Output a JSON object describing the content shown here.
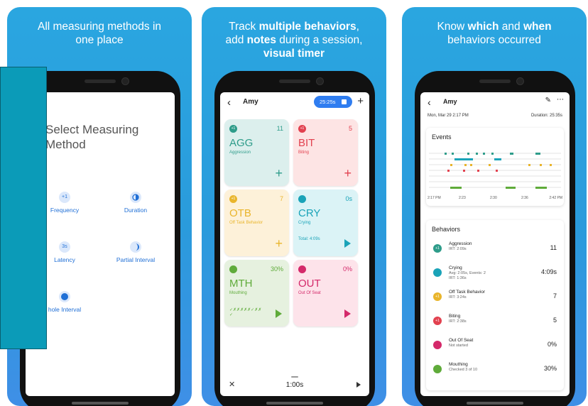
{
  "panel1": {
    "caption_line1": "All measuring methods in",
    "caption_line2": "one place",
    "title_line1": "Select Measuring",
    "title_line2": "Method",
    "methods": [
      {
        "label": "Frequency",
        "icon": "+1"
      },
      {
        "label": "Duration",
        "icon": "duration-icon"
      },
      {
        "label": "Latency",
        "icon": "3s"
      },
      {
        "label": "Partial Interval",
        "icon": "partial-interval-icon"
      },
      {
        "label": "hole Interval",
        "icon": "whole-interval-icon"
      }
    ]
  },
  "panel2": {
    "caption_line1_pre": "Track ",
    "caption_line1_bold": "multiple behaviors",
    "caption_line1_post": ",",
    "caption_line2_pre": "add ",
    "caption_line2_bold": "notes",
    "caption_line2_post": " during a session,",
    "caption_line3_bold": "visual timer",
    "user": "Amy",
    "timer": "25:25s",
    "cards": [
      {
        "abbr": "AGG",
        "name": "Aggression",
        "count": "11",
        "icon": "+1",
        "color": "#2e9c8a",
        "bg": "#dcefed"
      },
      {
        "abbr": "BIT",
        "name": "Biting",
        "count": "5",
        "icon": "+1",
        "color": "#e2414f",
        "bg": "#fde4e4"
      },
      {
        "abbr": "OTB",
        "name": "Off Task Behavior",
        "count": "7",
        "icon": "+1",
        "color": "#e9b52c",
        "bg": "#fdf1d9"
      },
      {
        "abbr": "CRY",
        "name": "Crying",
        "count": "0s",
        "extra": "Total: 4:09s",
        "icon": "duration-icon",
        "color": "#1aa3b8",
        "bg": "#dbf3f6"
      },
      {
        "abbr": "MTH",
        "name": "Mouthing",
        "count": "30%",
        "extra": "✓✗✗✗✗✗✓✗✗ ✓",
        "icon": "interval-icon",
        "color": "#5fab3a",
        "bg": "#e6f1df"
      },
      {
        "abbr": "OUT",
        "name": "Out Of Seat",
        "count": "0%",
        "icon": "interval-icon",
        "color": "#d4296a",
        "bg": "#fde3ea"
      }
    ],
    "bottom_timer": "1:00s"
  },
  "panel3": {
    "caption_line1_pre": "Know ",
    "caption_line1_bold1": "which",
    "caption_line1_mid": " and ",
    "caption_line1_bold2": "when",
    "caption_line2": "behaviors occurred",
    "user": "Amy",
    "date": "Mon, Mar 29 2:17 PM",
    "duration": "Duration: 25:35s",
    "events_title": "Events",
    "axis_ticks": [
      "2:17 PM",
      "2:23",
      "2:30",
      "2:36",
      "2:42 PM"
    ],
    "behaviors_title": "Behaviors",
    "behaviors": [
      {
        "name": "Aggression",
        "sub": "IRT: 2:09s",
        "value": "11",
        "color": "#2e9c8a",
        "icon": "+1"
      },
      {
        "name": "Crying",
        "sub": "Avg: 2:05s, Events: 2",
        "sub2": "IRT: 1:36s",
        "value": "4:09s",
        "color": "#1aa3b8",
        "icon": "duration-icon"
      },
      {
        "name": "Off Task Behavior",
        "sub": "IRT: 3:24s",
        "value": "7",
        "color": "#e9b52c",
        "icon": "+1"
      },
      {
        "name": "Biting",
        "sub": "IRT: 2:38s",
        "value": "5",
        "color": "#e2414f",
        "icon": "+1"
      },
      {
        "name": "Out Of Seat",
        "sub": "Not started",
        "value": "0%",
        "color": "#d4296a",
        "icon": "interval-icon"
      },
      {
        "name": "Mouthing",
        "sub": "Checked 3 of 10",
        "value": "30%",
        "color": "#5fab3a",
        "icon": "interval-icon"
      }
    ]
  }
}
